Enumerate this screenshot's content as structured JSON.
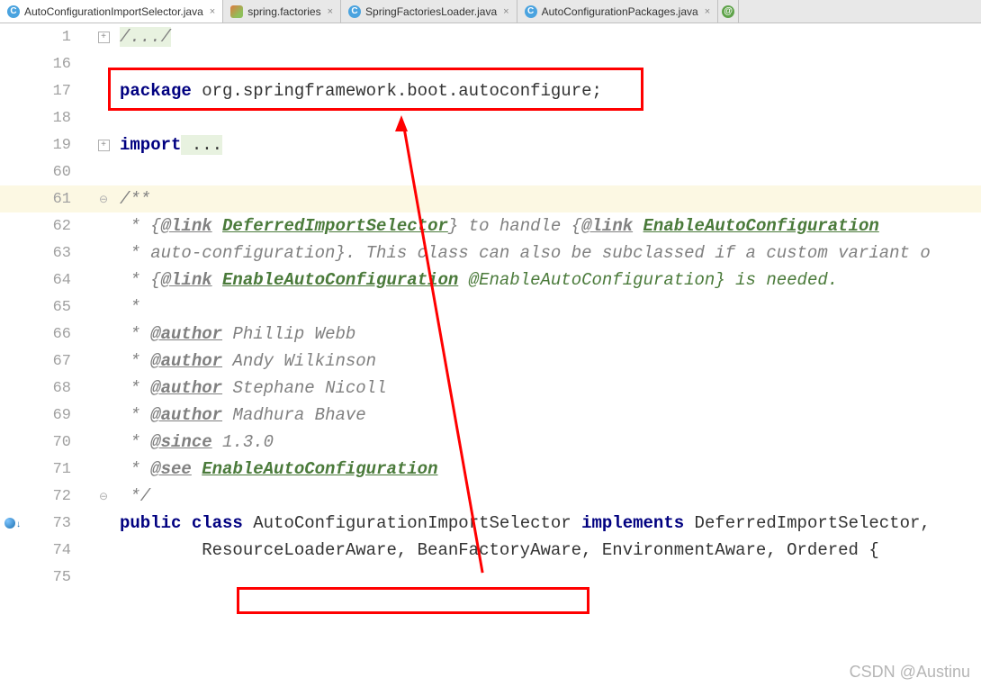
{
  "tabs": [
    {
      "label": "AutoConfigurationImportSelector.java",
      "icon": "c",
      "active": true
    },
    {
      "label": "spring.factories",
      "icon": "factories",
      "active": false
    },
    {
      "label": "SpringFactoriesLoader.java",
      "icon": "c",
      "active": false
    },
    {
      "label": "AutoConfigurationPackages.java",
      "icon": "c",
      "active": false
    }
  ],
  "lines": {
    "l1": {
      "num": "1"
    },
    "l16": {
      "num": "16"
    },
    "l17": {
      "num": "17"
    },
    "l18": {
      "num": "18"
    },
    "l19": {
      "num": "19"
    },
    "l60": {
      "num": "60"
    },
    "l61": {
      "num": "61"
    },
    "l62": {
      "num": "62"
    },
    "l63": {
      "num": "63"
    },
    "l64": {
      "num": "64"
    },
    "l65": {
      "num": "65"
    },
    "l66": {
      "num": "66"
    },
    "l67": {
      "num": "67"
    },
    "l68": {
      "num": "68"
    },
    "l69": {
      "num": "69"
    },
    "l70": {
      "num": "70"
    },
    "l71": {
      "num": "71"
    },
    "l72": {
      "num": "72"
    },
    "l73": {
      "num": "73"
    },
    "l74": {
      "num": "74"
    },
    "l75": {
      "num": "75"
    }
  },
  "code": {
    "c1_fold": "/.../",
    "c17_kw": "package",
    "c17_rest": " org.springframework.boot.autoconfigure;",
    "c19_kw": "import",
    "c19_rest": " ...",
    "c61": "/**",
    "c62_pre": " * {",
    "c62_tag": "@link",
    "c62_sp": " ",
    "c62_link": "DeferredImportSelector",
    "c62_mid": "} to handle {",
    "c62_tag2": "@link",
    "c62_sp2": " ",
    "c62_link2": "EnableAutoConfiguration",
    "c63": " * auto-configuration}. This class can also be subclassed if a custom variant o",
    "c64_pre": " * {",
    "c64_tag": "@link",
    "c64_sp": " ",
    "c64_link": "EnableAutoConfiguration",
    "c64_rest": " @EnableAutoConfiguration} is needed.",
    "c65": " *",
    "c66_pre": " * ",
    "c66_tag": "@author",
    "c66_rest": " Phillip Webb",
    "c67_pre": " * ",
    "c67_tag": "@author",
    "c67_rest": " Andy Wilkinson",
    "c68_pre": " * ",
    "c68_tag": "@author",
    "c68_rest": " Stephane Nicoll",
    "c69_pre": " * ",
    "c69_tag": "@author",
    "c69_rest": " Madhura Bhave",
    "c70_pre": " * ",
    "c70_tag": "@since",
    "c70_rest": " 1.3.0",
    "c71_pre": " * ",
    "c71_tag": "@see",
    "c71_sp": " ",
    "c71_link": "EnableAutoConfiguration",
    "c72": " */",
    "c73_kw1": "public",
    "c73_sp1": " ",
    "c73_kw2": "class",
    "c73_sp2": " ",
    "c73_name": "AutoConfigurationImportSelector ",
    "c73_kw3": "implements",
    "c73_rest": " DeferredImportSelector,",
    "c74": "        ResourceLoaderAware, BeanFactoryAware, EnvironmentAware, Ordered {"
  },
  "watermark": "CSDN @Austinu"
}
